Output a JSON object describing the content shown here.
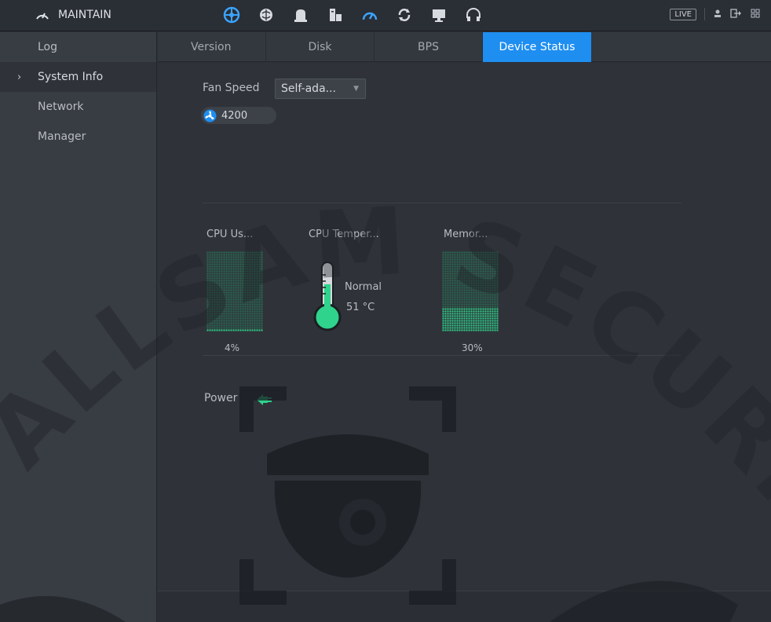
{
  "header": {
    "title": "MAINTAIN",
    "modules": [
      "camera-icon",
      "brain-icon",
      "bell-icon",
      "storage-icon",
      "maintain-icon",
      "backup-icon",
      "display-icon",
      "audio-icon"
    ],
    "live_label": "LIVE"
  },
  "sidebar": {
    "items": [
      {
        "label": "Log",
        "active": false
      },
      {
        "label": "System Info",
        "active": true
      },
      {
        "label": "Network",
        "active": false
      },
      {
        "label": "Manager",
        "active": false
      }
    ]
  },
  "tabs": [
    {
      "label": "Version",
      "active": false
    },
    {
      "label": "Disk",
      "active": false
    },
    {
      "label": "BPS",
      "active": false
    },
    {
      "label": "Device Status",
      "active": true
    }
  ],
  "device_status": {
    "fan_speed_label": "Fan Speed",
    "fan_mode": "Self-ada...",
    "fan_rpm": "4200",
    "cpu_usage_label": "CPU Us...",
    "cpu_usage_pct": "4%",
    "cpu_usage_value": 4,
    "cpu_temp_label": "CPU Temper...",
    "cpu_temp_status": "Normal",
    "cpu_temp_value": "51 °C",
    "memory_label": "Memor...",
    "memory_pct": "30%",
    "memory_value": 30,
    "power_label": "Power"
  },
  "watermark": {
    "text": "ALLSAM SECURITY"
  },
  "colors": {
    "accent": "#1e8ef0",
    "meter_green": "#2fd38c",
    "sidebar_bg": "#383c43",
    "content_bg": "#2f3339"
  }
}
